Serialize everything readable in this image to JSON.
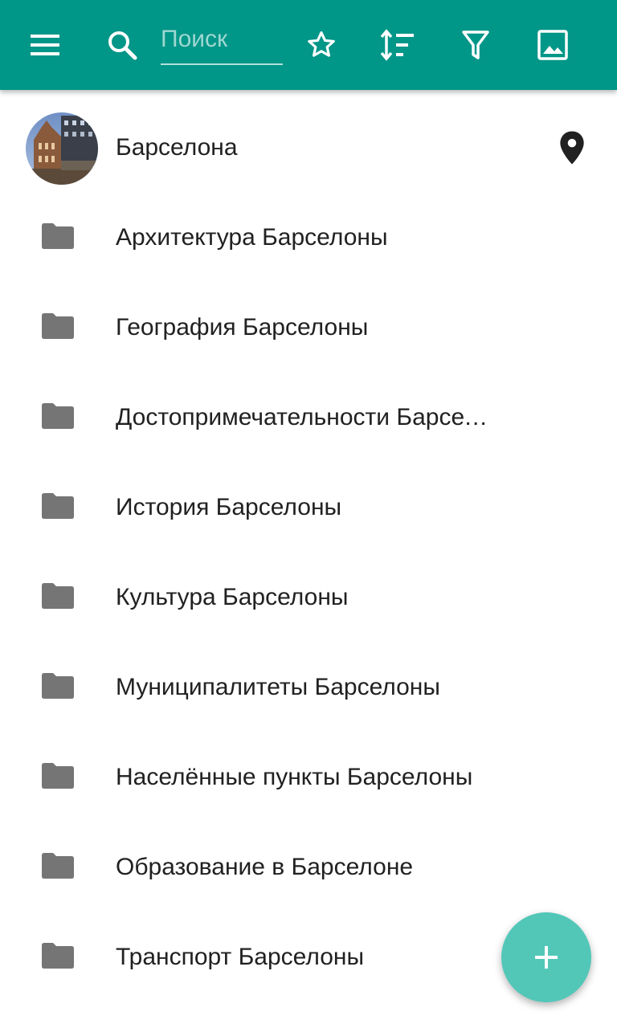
{
  "toolbar": {
    "background_color": "#009688",
    "menu_icon": "menu-icon",
    "search_icon": "search-icon",
    "search_placeholder": "Поиск",
    "search_value": "",
    "star_icon": "star-outline-icon",
    "sort_icon": "sort-icon",
    "filter_icon": "filter-icon",
    "image_icon": "image-icon"
  },
  "list": {
    "header": {
      "label": "Барселона",
      "avatar_icon": "barcelona-photo-avatar",
      "location_icon": "map-marker-icon"
    },
    "items": [
      {
        "label": "Архитектура Барселоны",
        "icon": "folder-icon"
      },
      {
        "label": "География Барселоны",
        "icon": "folder-icon"
      },
      {
        "label": "Достопримечательности Барселоны",
        "icon": "folder-icon"
      },
      {
        "label": "История Барселоны",
        "icon": "folder-icon"
      },
      {
        "label": "Культура Барселоны",
        "icon": "folder-icon"
      },
      {
        "label": "Муниципалитеты Барселоны",
        "icon": "folder-icon"
      },
      {
        "label": "Населённые пункты Барселоны",
        "icon": "folder-icon"
      },
      {
        "label": "Образование в Барселоне",
        "icon": "folder-icon"
      },
      {
        "label": "Транспорт Барселоны",
        "icon": "folder-icon"
      }
    ]
  },
  "fab": {
    "icon": "plus-icon",
    "color": "#52c7b8"
  },
  "colors": {
    "folder": "#757575",
    "text": "#212121"
  }
}
